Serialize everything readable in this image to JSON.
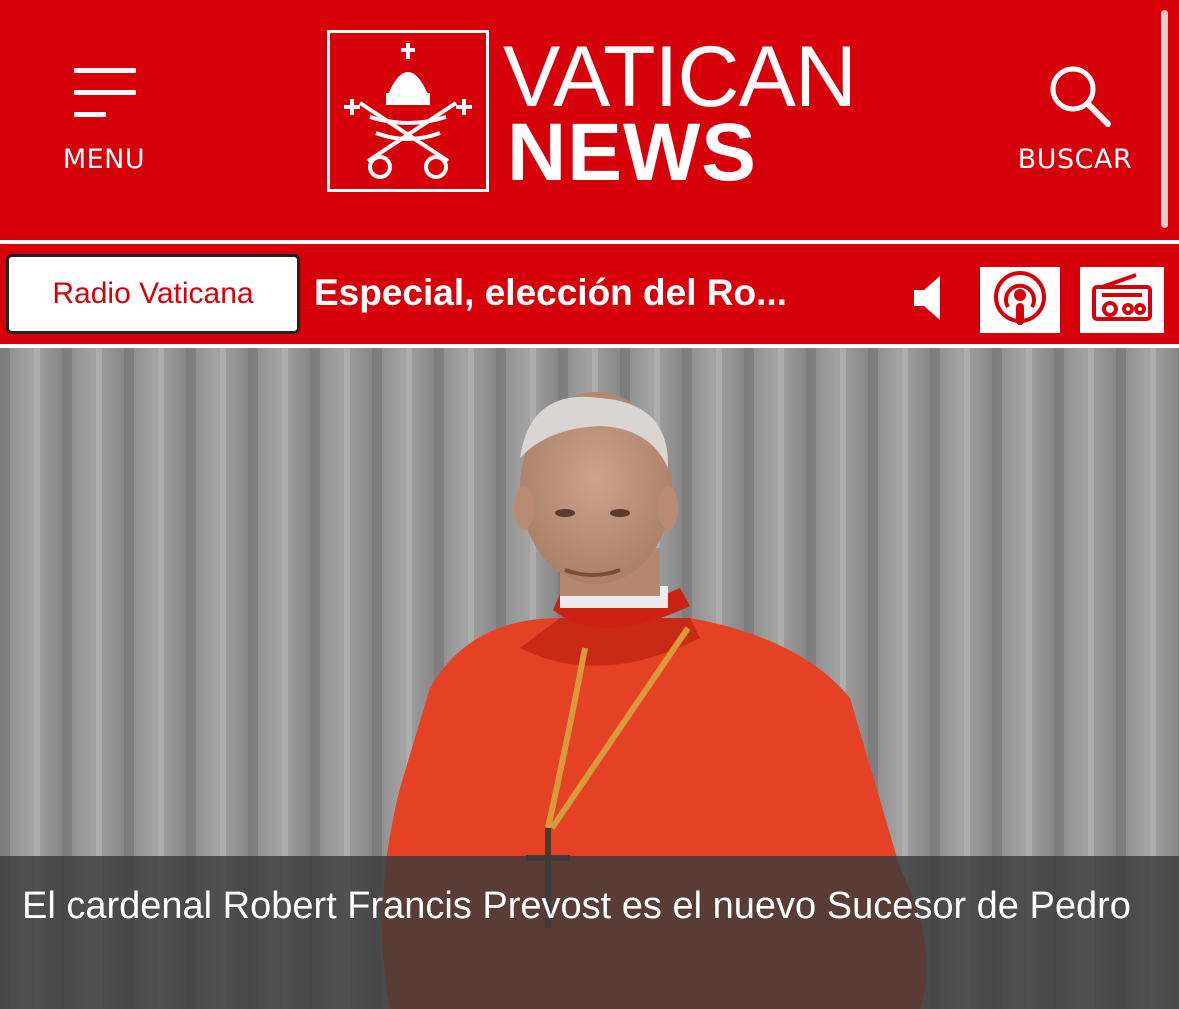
{
  "header": {
    "menu_label": "MENU",
    "logo_line1": "VATICAN",
    "logo_line2": "NEWS",
    "search_label": "BUSCAR",
    "brand_color": "#d50009"
  },
  "radio": {
    "badge_label": "Radio Vaticana",
    "now_playing": "Especial, elección del Ro...",
    "icons": [
      "speaker-icon",
      "podcast-icon",
      "radio-icon"
    ]
  },
  "hero": {
    "headline": "El cardenal Robert Francis Prevost es el nuevo Sucesor de Pedro"
  }
}
